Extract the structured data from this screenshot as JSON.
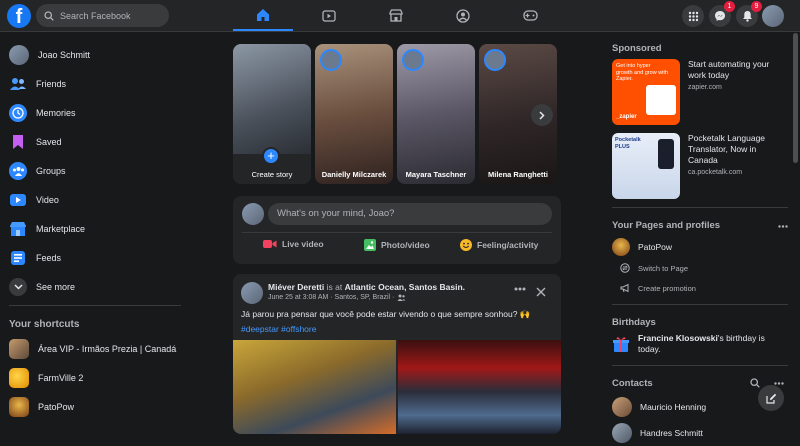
{
  "topbar": {
    "logo": "f",
    "search_placeholder": "Search Facebook",
    "nav_icons": [
      "home-icon",
      "watch-icon",
      "marketplace-icon",
      "groups-icon",
      "gaming-icon"
    ],
    "messenger_badge": "1",
    "notifications_badge": "9"
  },
  "left": {
    "items": [
      {
        "label": "Joao Schmitt",
        "icon": "profile-avatar"
      },
      {
        "label": "Friends",
        "icon": "friends-icon"
      },
      {
        "label": "Memories",
        "icon": "memories-icon"
      },
      {
        "label": "Saved",
        "icon": "saved-icon"
      },
      {
        "label": "Groups",
        "icon": "groups-icon"
      },
      {
        "label": "Video",
        "icon": "video-icon"
      },
      {
        "label": "Marketplace",
        "icon": "marketplace-icon"
      },
      {
        "label": "Feeds",
        "icon": "feeds-icon"
      },
      {
        "label": "See more",
        "icon": "chevron-down-icon"
      }
    ],
    "shortcuts_title": "Your shortcuts",
    "shortcuts": [
      {
        "label": "Área VIP - Irmãos Prezia | Canadá"
      },
      {
        "label": "FarmVille 2"
      },
      {
        "label": "PatoPow"
      }
    ]
  },
  "stories": [
    {
      "name": "Create story"
    },
    {
      "name": "Danielly Milczarek"
    },
    {
      "name": "Mayara Taschner"
    },
    {
      "name": "Milena Ranghetti"
    }
  ],
  "composer": {
    "placeholder": "What's on your mind, Joao?",
    "live": "Live video",
    "photo": "Photo/video",
    "feeling": "Feeling/activity"
  },
  "post": {
    "author": "Miéver Deretti",
    "is_at": "is at",
    "place": "Atlantic Ocean, Santos Basin.",
    "meta": "June 25 at 3:08 AM · Santos, SP, Brazil ·",
    "text": "Já parou pra pensar que você pode estar vivendo o que sempre sonhou? 🙌",
    "hashtags": "#deepstar #offshore"
  },
  "right": {
    "sponsored_title": "Sponsored",
    "ads": [
      {
        "title": "Start automating your work today",
        "url": "zapier.com",
        "img_text": "Get into hyper growth and grow with Zapier.",
        "brand": "_zapier"
      },
      {
        "title": "Pocketalk Language Translator, Now in Canada",
        "url": "ca.pocketalk.com",
        "brand": "Pocketalk PLUS"
      }
    ],
    "pages_title": "Your Pages and profiles",
    "page_name": "PatoPow",
    "switch": "Switch to Page",
    "promo": "Create promotion",
    "birthdays_title": "Birthdays",
    "birthday_name": "Francine Klosowski",
    "birthday_text": "'s birthday is today.",
    "contacts_title": "Contacts",
    "contacts": [
      "Mauricio Henning",
      "Handres Schmitt"
    ]
  },
  "colors": {
    "accent": "#2d88ff",
    "brand": "#1877f2",
    "bg": "#18191a",
    "card": "#242526"
  }
}
